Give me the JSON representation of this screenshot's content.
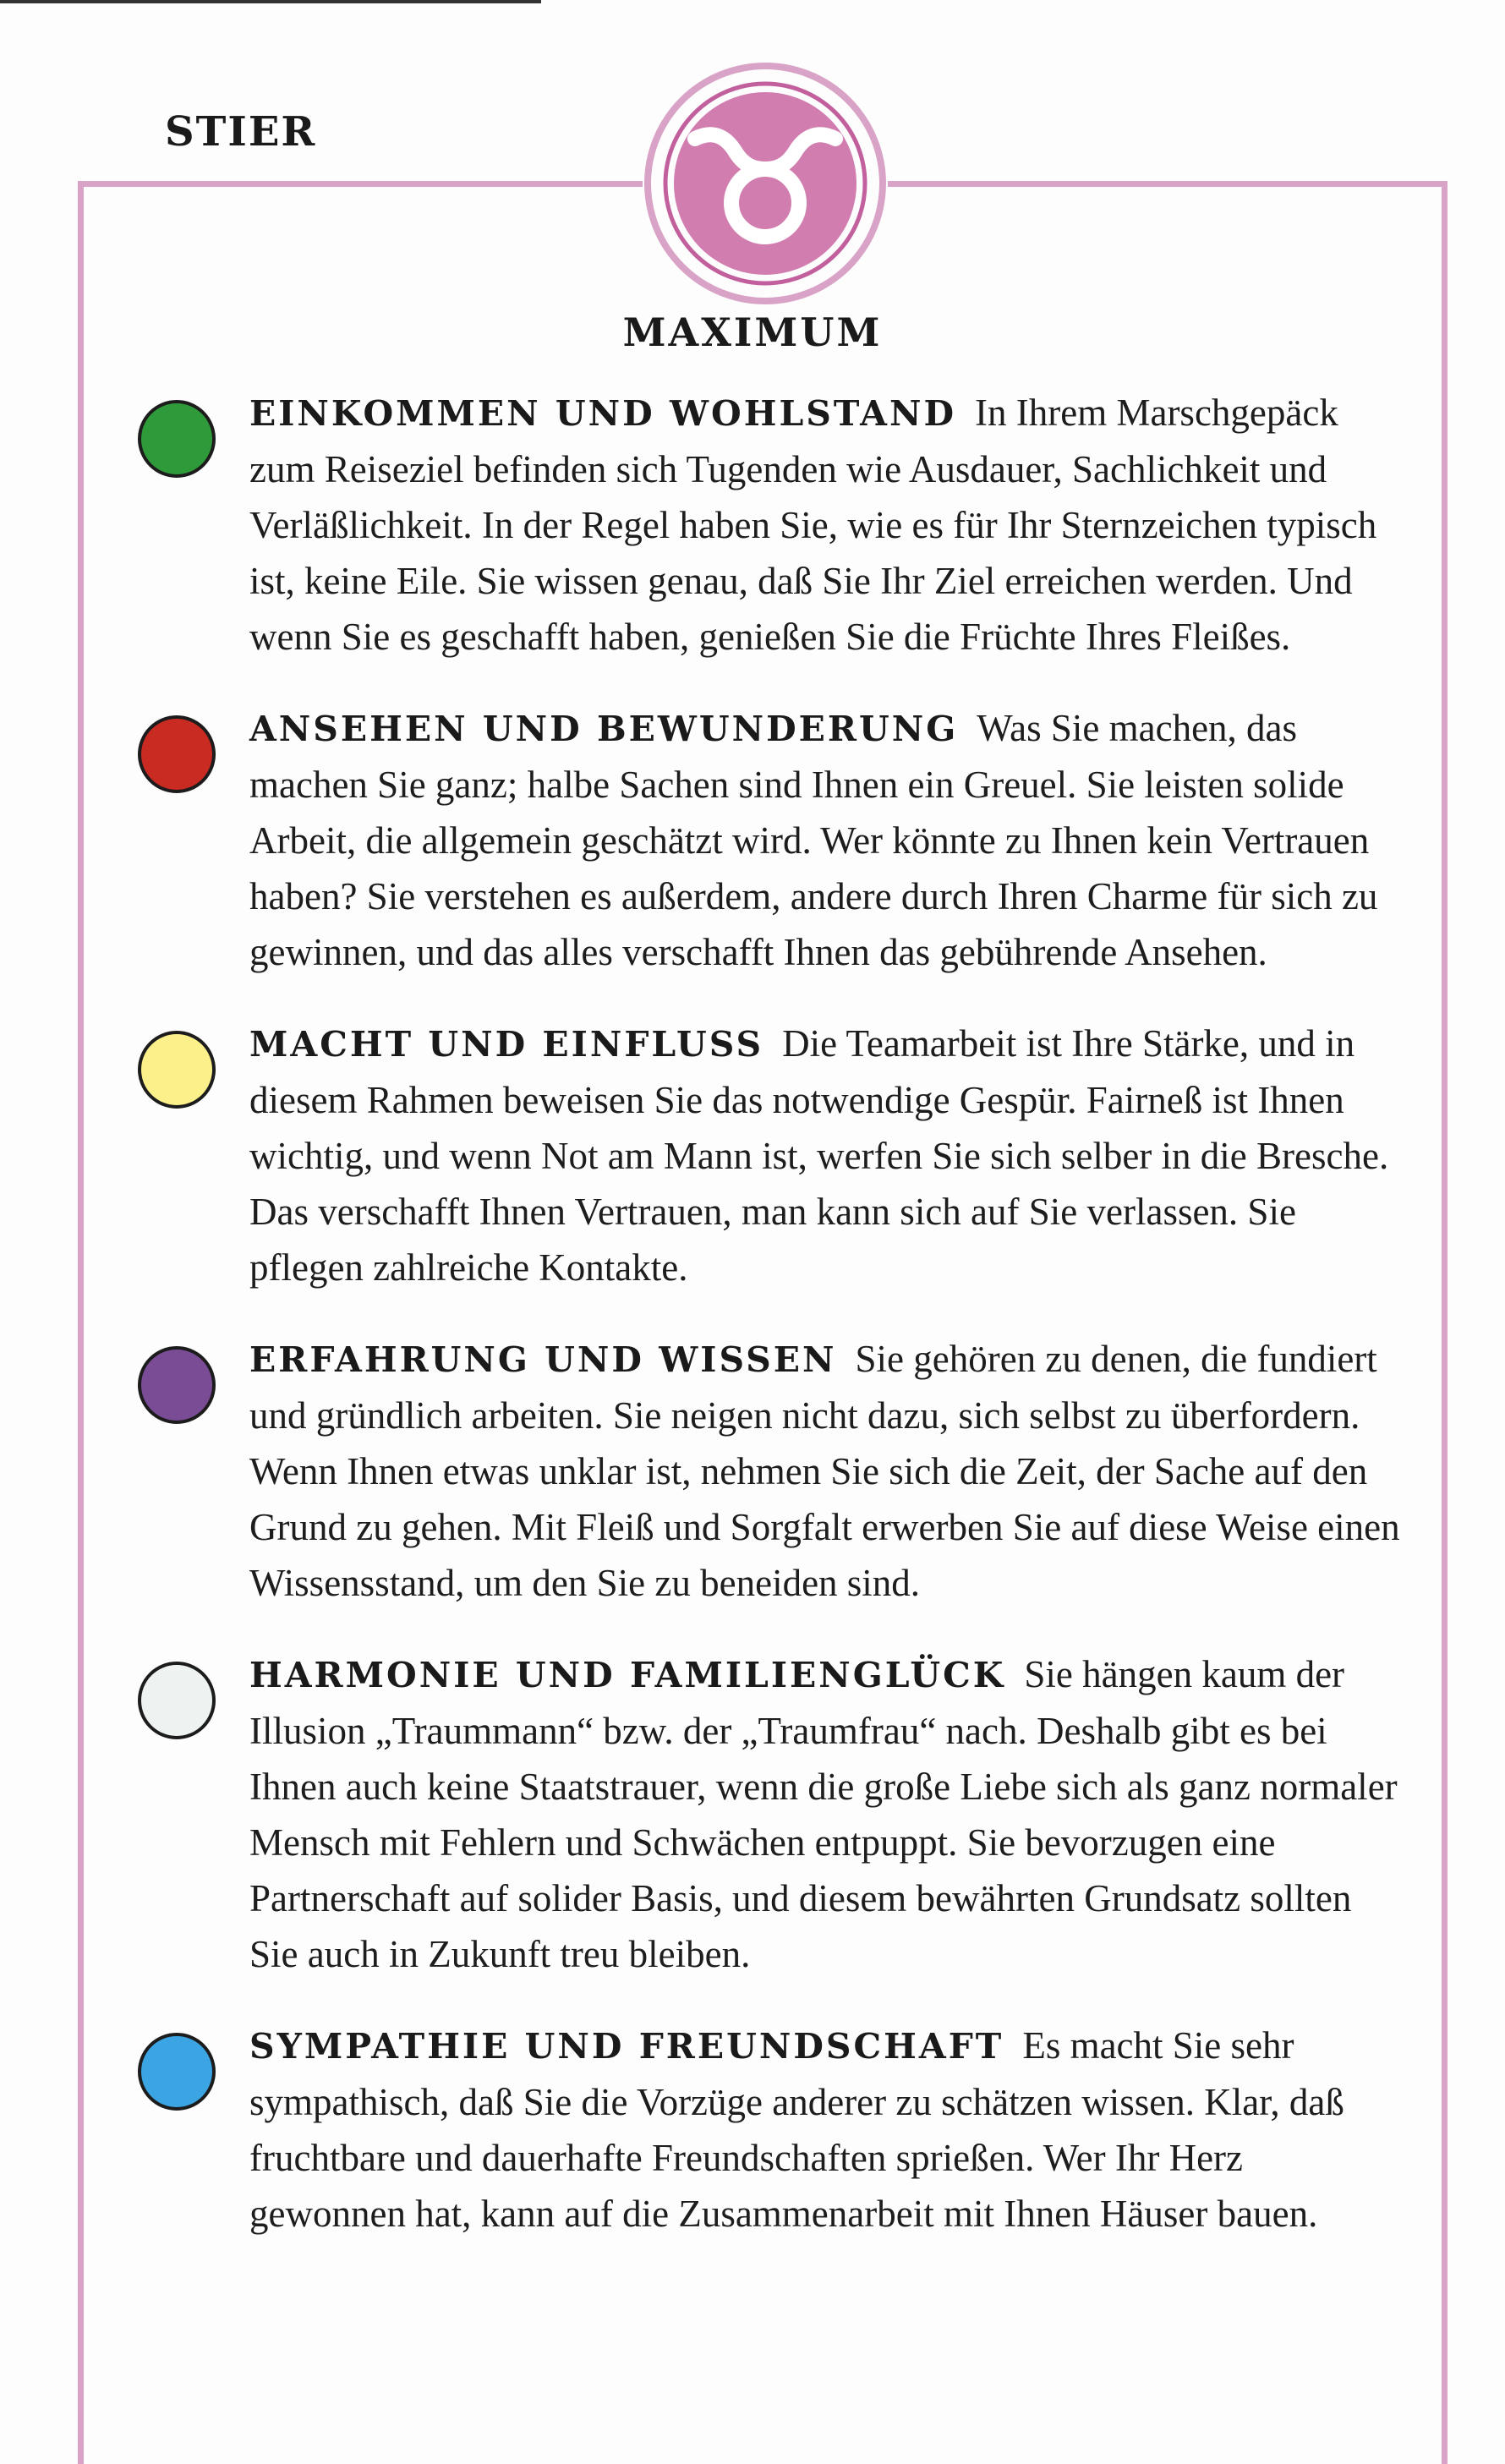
{
  "page": {
    "sign": "STIER",
    "heading": "MAXIMUM"
  },
  "colors": {
    "frame": "#d9a3c7",
    "emblem_fill": "#d27db0",
    "emblem_symbol": "#ffffff"
  },
  "emblem": {
    "icon": "taurus-zodiac-icon"
  },
  "entries": [
    {
      "title": "EINKOMMEN UND WOHLSTAND",
      "color": "#2e9a3a",
      "text": "In Ihrem Marschgepäck zum Reiseziel befinden sich Tugenden wie Ausdauer, Sachlichkeit und Verläßlichkeit. In der Regel haben Sie, wie es für Ihr Sternzeichen typisch ist, keine Eile. Sie wissen genau, daß Sie Ihr Ziel erreichen werden. Und wenn Sie es geschafft haben, genießen Sie die Früchte Ihres Fleißes."
    },
    {
      "title": "ANSEHEN UND BEWUNDERUNG",
      "color": "#c92a22",
      "text": "Was Sie machen, das machen Sie ganz; halbe Sachen sind Ihnen ein Greuel. Sie leisten solide Arbeit, die allgemein geschätzt wird. Wer könnte zu Ihnen kein Vertrauen haben? Sie verstehen es außerdem, andere durch Ihren Charme für sich zu gewinnen, und das alles verschafft Ihnen das gebührende Ansehen."
    },
    {
      "title": "MACHT UND EINFLUSS",
      "color": "#fbf08a",
      "text": "Die Teamarbeit ist Ihre Stärke, und in diesem Rahmen beweisen Sie das notwendige Gespür. Fairneß ist Ihnen wichtig, und wenn Not am Mann ist, werfen Sie sich selber in die Bresche. Das verschafft Ihnen Vertrauen, man kann sich auf Sie verlassen. Sie pflegen zahlreiche Kontakte."
    },
    {
      "title": "ERFAHRUNG UND WISSEN",
      "color": "#7a4c96",
      "text": "Sie gehören zu denen, die fundiert und gründlich arbeiten. Sie neigen nicht dazu, sich selbst zu überfordern. Wenn Ihnen etwas unklar ist, nehmen Sie sich die Zeit, der Sache auf den Grund zu gehen. Mit Fleiß und Sorgfalt erwerben Sie auf diese Weise einen Wissensstand, um den Sie zu beneiden sind."
    },
    {
      "title": "HARMONIE UND FAMILIENGLÜCK",
      "color": "#eef3f1",
      "text": "Sie hängen kaum der Illusion „Traummann“ bzw. der „Traumfrau“ nach. Deshalb gibt es bei Ihnen auch keine Staatstrauer, wenn die große Liebe sich als ganz normaler Mensch mit Fehlern und Schwächen entpuppt. Sie bevorzugen eine Partnerschaft auf solider Basis, und diesem bewährten Grundsatz sollten Sie auch in Zukunft treu bleiben."
    },
    {
      "title": "SYMPATHIE UND FREUNDSCHAFT",
      "color": "#3ba4e3",
      "text": "Es macht Sie sehr sympathisch, daß Sie die Vorzüge anderer zu schätzen wissen. Klar, daß fruchtbare und dauerhafte Freundschaften sprießen. Wer Ihr Herz gewonnen hat, kann auf die Zusammenarbeit mit Ihnen Häuser bauen."
    }
  ]
}
